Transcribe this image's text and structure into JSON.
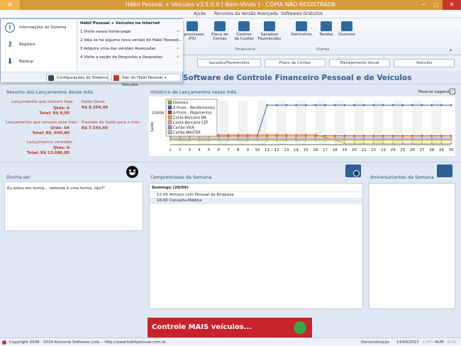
{
  "window": {
    "title": "Hábil Pessoal + Veículos v3.5.0.0 [ Bem-Vindo ] - CÓPIA NÃO REGISTRADA",
    "minimize": "−",
    "maximize": "□",
    "close": "✕"
  },
  "menu": {
    "items": [
      "Ajuda",
      "Recursos da Versão Avançada",
      "Softwares Gratuitos"
    ]
  },
  "ribbon": {
    "buttons": [
      {
        "label": "...promissos",
        "label2": "(F5)"
      },
      {
        "label": "Plano de",
        "label2": "Contas"
      },
      {
        "label": "Centros",
        "label2": "de Custos"
      },
      {
        "label": "Sacados/",
        "label2": "Favorecidos"
      },
      {
        "label": "Patrimônio",
        "label2": ""
      },
      {
        "label": "Tarefas",
        "label2": ""
      },
      {
        "label": "Diversos",
        "label2": ""
      }
    ],
    "groups": [
      "Financeiro",
      "Outros"
    ]
  },
  "file_menu": {
    "left_items": [
      "Informações do Sistema",
      "Registro",
      "Backup"
    ],
    "right_title": "Hábil Pessoal + Veículos na Internet",
    "right_items": [
      "1 Visite nossa home-page",
      "2 Veja se há alguma nova versão do Hábil Pessoal...",
      "3 Adquira uma das versões Avançadas",
      "4 Visite a seção de Perguntas e Respostas"
    ],
    "settings_button": "Configurações do Sistema",
    "exit_button": "Sair do Hábil Pessoal + Veículos"
  },
  "tabs": [
    "Sacados/Favorecidos",
    "Plano de Contas",
    "Planejamento Anual",
    "Veículos"
  ],
  "page_title": "Software de Controle Financeiro Pessoal e de Veículos",
  "summary": {
    "title": "Resumo dos Lançamentos desse mês",
    "today_label": "Lançamentos que vencem hoje:",
    "today_qty": "Qtde: 0",
    "today_total": "Total: R$ 0,00",
    "week_label": "Lançamentos que vencem esse mês:",
    "week_qty": "Qtde: 64",
    "week_total": "Total: R$ -660,80",
    "overdue_label": "Lançamentos vencidos:",
    "overdue_qty": "Qtde: 9",
    "overdue_total": "Total: R$ 13.680,80",
    "balance_label": "Saldo Geral:",
    "balance_value": "R$ 8.204,40",
    "forecast_label": "Previsão de Saldo para o mês:",
    "forecast_value": "R$ 7.543,60"
  },
  "history": {
    "title": "Histórico de Lançamentos nesse mês",
    "show_legend": "Mostrar Legenda",
    "show_legend_checked": "✓"
  },
  "chart_data": {
    "type": "line",
    "ylabel": "Saldo",
    "y_tick_label": "10000",
    "x": [
      1,
      2,
      3,
      4,
      5,
      6,
      7,
      8,
      9,
      10,
      11,
      12,
      13,
      14,
      15,
      16,
      17,
      18,
      19,
      20,
      21,
      22,
      23,
      24,
      25,
      26,
      27,
      28,
      29,
      30
    ],
    "series": [
      {
        "name": "Dinheiro",
        "color": "#77b43b",
        "values": [
          500,
          500,
          500,
          500,
          500,
          500,
          500,
          500,
          500,
          500,
          500,
          500,
          500,
          500,
          500,
          500,
          500,
          500,
          500,
          500,
          500,
          500,
          500,
          500,
          500,
          500,
          500,
          500,
          500,
          500
        ]
      },
      {
        "name": "A Prazo - Recebimentos",
        "color": "#3a66b5",
        "values": [
          2000,
          2000,
          2000,
          2000,
          2000,
          2000,
          2000,
          2000,
          2000,
          2000,
          12500,
          12500,
          12500,
          12500,
          12500,
          12500,
          12500,
          12500,
          12500,
          12500,
          12500,
          12500,
          12500,
          12500,
          12500,
          12500,
          12500,
          12500,
          12500,
          12500
        ]
      },
      {
        "name": "A Prazo - Pagamentos",
        "color": "#c23a2d",
        "values": [
          2000,
          2000,
          2000,
          2000,
          2000,
          2000,
          2000,
          2000,
          2000,
          2000,
          2000,
          2000,
          2000,
          2000,
          2000,
          2000,
          2000,
          2000,
          2000,
          2000,
          2000,
          2000,
          2000,
          2000,
          2000,
          2000,
          2000,
          2000,
          2000,
          2000
        ]
      },
      {
        "name": "Conta Bancária BB",
        "color": "#e0a53a",
        "values": [
          2500,
          2500,
          2500,
          2500,
          2500,
          2500,
          2500,
          2500,
          2500,
          2500,
          2500,
          2500,
          2500,
          2500,
          2500,
          2500,
          1500,
          500,
          -500,
          -500,
          -500,
          -500,
          -500,
          -500,
          -500,
          -500,
          -500,
          -500,
          -500,
          -500
        ]
      },
      {
        "name": "Conta Bancária CEF",
        "color": "#d6a58a",
        "values": [
          1500,
          1500,
          1500,
          1500,
          1500,
          1500,
          1500,
          1500,
          1500,
          1500,
          1500,
          1500,
          1500,
          1500,
          1500,
          1500,
          1500,
          1500,
          1500,
          1500,
          1500,
          1500,
          1500,
          1500,
          1500,
          1500,
          1500,
          1500,
          1500,
          1500
        ]
      },
      {
        "name": "Cartão VISA",
        "color": "#9a8ac4",
        "values": [
          1000,
          1000,
          1000,
          1000,
          1000,
          1000,
          1000,
          1000,
          1000,
          1000,
          1000,
          1000,
          1000,
          1000,
          1000,
          1000,
          1000,
          1000,
          1000,
          1000,
          1000,
          1000,
          1000,
          1000,
          1000,
          1000,
          1000,
          1000,
          1000,
          1000
        ]
      },
      {
        "name": "Cartão MASTER",
        "color": "#c9b89a",
        "values": [
          800,
          800,
          800,
          800,
          800,
          800,
          800,
          800,
          800,
          800,
          800,
          800,
          800,
          800,
          800,
          800,
          800,
          800,
          800,
          800,
          800,
          800,
          800,
          800,
          800,
          800,
          800,
          800,
          800,
          800
        ]
      }
    ],
    "ylim": [
      -1000,
      14000
    ]
  },
  "fun": {
    "title": "Divirta-se!",
    "text": "Eu estou em forma... redondo é uma forma, não?\""
  },
  "schedule": {
    "title": "Compromissos da Semana",
    "day": "Domingo (20/09)",
    "rows": [
      {
        "time": "12:00",
        "text": "Almoço com Pessoal da Empresa"
      },
      {
        "time": "16:00",
        "text": "Consulta Médica"
      }
    ]
  },
  "birthdays": {
    "title": "Aniversariantes da Semana"
  },
  "ad": {
    "text": "Controle MAIS veículos..."
  },
  "status": {
    "copyright": "Copyright 2006 - 2010 Koinonia Software Ltda. - http://www.habilpessoal.com.br",
    "mode": "Demonstração",
    "date": "14/09/2015",
    "caps": "CAPS",
    "num": "NUM",
    "scrl": "SCRL"
  }
}
